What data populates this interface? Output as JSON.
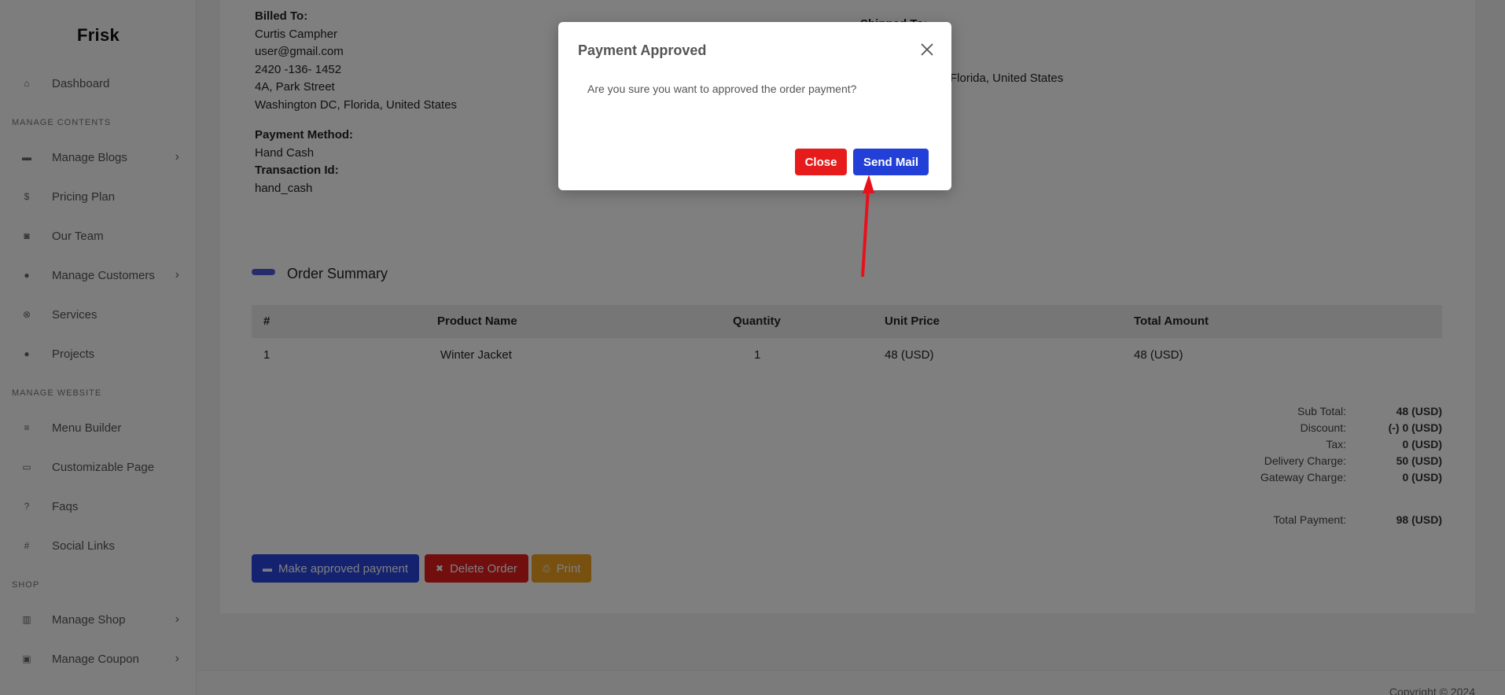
{
  "sidebar": {
    "brand": "Frisk",
    "items": [
      {
        "label": "Dashboard",
        "icon": "home-icon",
        "glyph": "⌂"
      },
      {
        "label": "Manage Blogs",
        "icon": "blog-icon",
        "glyph": "▬",
        "has_submenu": true
      },
      {
        "label": "Pricing Plan",
        "icon": "dollar-icon",
        "glyph": "$"
      },
      {
        "label": "Our Team",
        "icon": "team-icon",
        "glyph": "◙"
      },
      {
        "label": "Manage Customers",
        "icon": "users-icon",
        "glyph": "●",
        "has_submenu": true
      },
      {
        "label": "Services",
        "icon": "gear-icon",
        "glyph": "⊗"
      },
      {
        "label": "Projects",
        "icon": "lightbulb-icon",
        "glyph": "●"
      },
      {
        "label": "Menu Builder",
        "icon": "menu-icon",
        "glyph": "≡"
      },
      {
        "label": "Customizable Page",
        "icon": "page-icon",
        "glyph": "▭"
      },
      {
        "label": "Faqs",
        "icon": "question-icon",
        "glyph": "?"
      },
      {
        "label": "Social Links",
        "icon": "hash-icon",
        "glyph": "#"
      },
      {
        "label": "Manage Shop",
        "icon": "shop-icon",
        "glyph": "▥",
        "has_submenu": true
      },
      {
        "label": "Manage Coupon",
        "icon": "coupon-icon",
        "glyph": "▣",
        "has_submenu": true
      }
    ],
    "sections": [
      "MANAGE CONTENTS",
      "MANAGE WEBSITE",
      "SHOP"
    ]
  },
  "billing": {
    "heading": "Billed To:",
    "name": "Curtis Campher",
    "email": "user@gmail.com",
    "phone": "2420 -136- 1452",
    "address1": "4A, Park Street",
    "address2": "Washington DC, Florida, United States",
    "payment_method_label": "Payment Method:",
    "payment_method": "Hand Cash",
    "transaction_label": "Transaction Id:",
    "transaction_id": "hand_cash"
  },
  "shipping": {
    "address_tail": "Florida, United States"
  },
  "order_summary": {
    "title": "Order Summary",
    "columns": [
      "#",
      "Product Name",
      "Quantity",
      "Unit Price",
      "Total Amount"
    ],
    "rows": [
      {
        "num": "1",
        "product": "Winter Jacket",
        "qty": "1",
        "unit_price": "48 (USD)",
        "total": "48 (USD)"
      }
    ]
  },
  "totals": {
    "sub_total_label": "Sub Total:",
    "sub_total": "48 (USD)",
    "discount_label": "Discount:",
    "discount": "(-) 0 (USD)",
    "tax_label": "Tax:",
    "tax": "0 (USD)",
    "delivery_label": "Delivery Charge:",
    "delivery": "50 (USD)",
    "gateway_label": "Gateway Charge:",
    "gateway": "0 (USD)",
    "total_label": "Total Payment:",
    "total": "98 (USD)"
  },
  "actions": {
    "approve": "Make approved payment",
    "delete": "Delete Order",
    "print": "Print"
  },
  "footer": {
    "copyright": "Copyright © 2024"
  },
  "modal": {
    "title": "Payment Approved",
    "message": "Are you sure you want to approved the order payment?",
    "close_label": "Close",
    "send_label": "Send Mail"
  },
  "colors": {
    "primary": "#2240d8",
    "danger": "#e61c1c",
    "warning": "#f0a020",
    "annotation_arrow": "#e8111b"
  }
}
